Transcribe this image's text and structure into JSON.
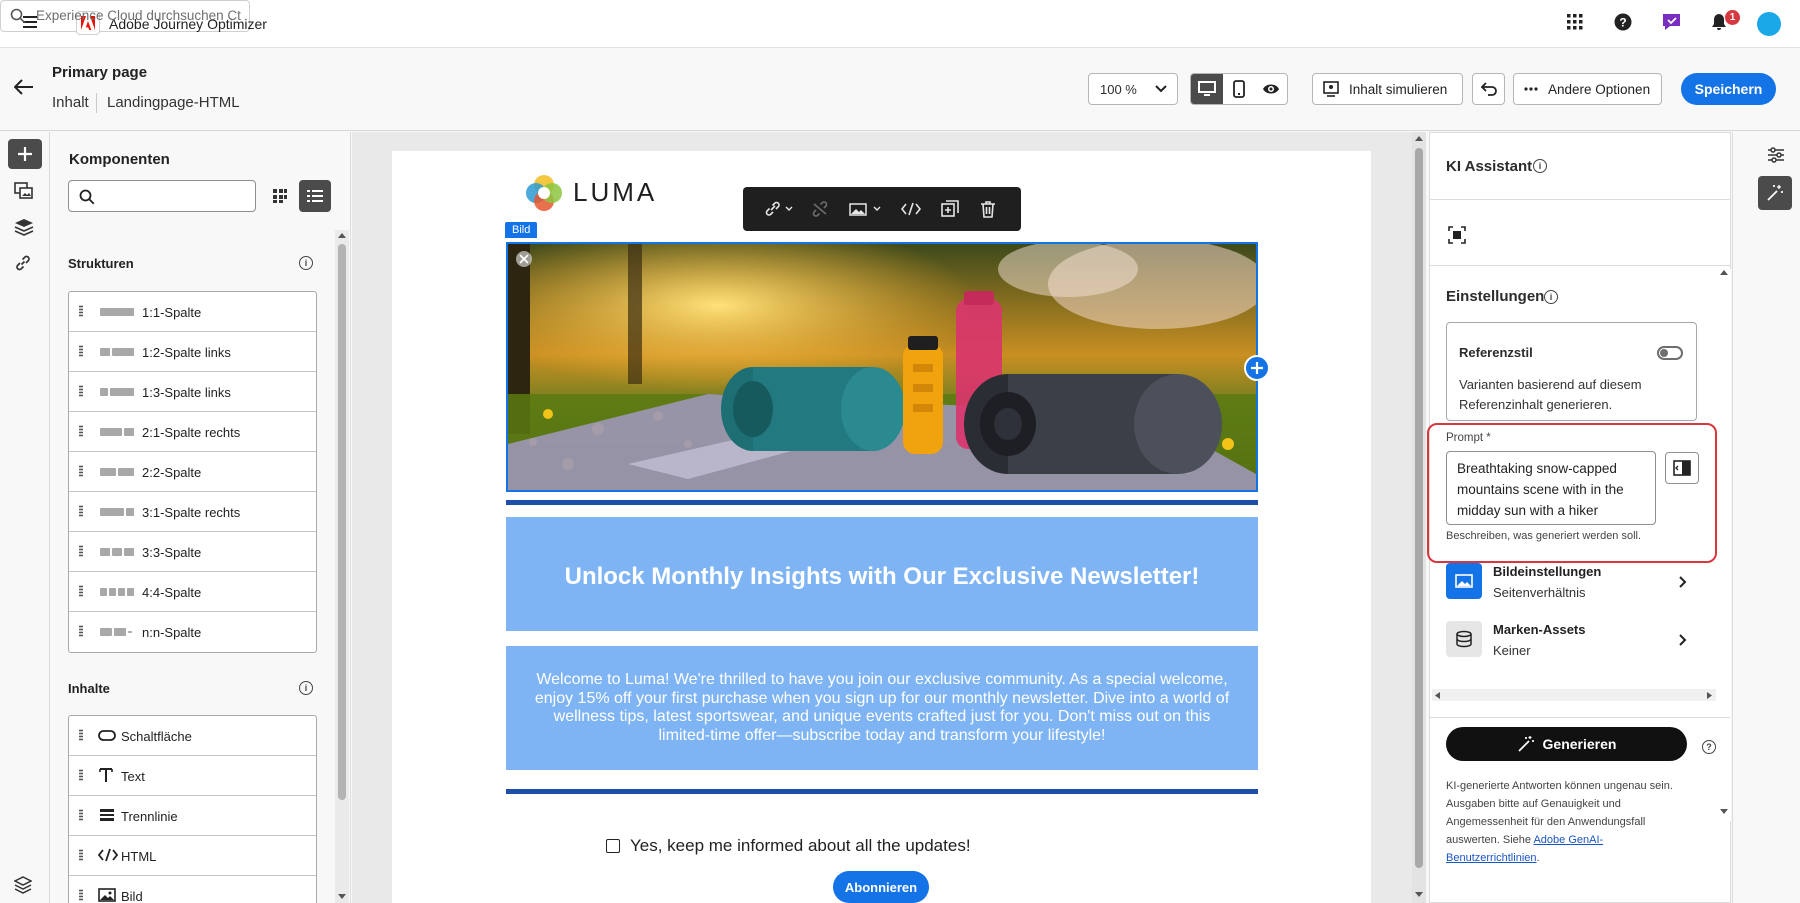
{
  "app": {
    "name": "Adobe Journey Optimizer",
    "search_placeholder": "Experience Cloud durchsuchen Ct...",
    "notification_count": "1"
  },
  "header": {
    "title": "Primary page",
    "breadcrumb": [
      "Inhalt",
      "Landingpage-HTML"
    ],
    "zoom": "100 %",
    "simulate_label": "Inhalt simulieren",
    "more_label": "Andere Optionen",
    "save_label": "Speichern"
  },
  "components": {
    "title": "Komponenten",
    "structures_title": "Strukturen",
    "structures": [
      {
        "label": "1:1-Spalte"
      },
      {
        "label": "1:2-Spalte links"
      },
      {
        "label": "1:3-Spalte links"
      },
      {
        "label": "2:1-Spalte rechts"
      },
      {
        "label": "2:2-Spalte"
      },
      {
        "label": "3:1-Spalte rechts"
      },
      {
        "label": "3:3-Spalte"
      },
      {
        "label": "4:4-Spalte"
      },
      {
        "label": "n:n-Spalte"
      }
    ],
    "contents_title": "Inhalte",
    "contents": [
      {
        "label": "Schaltfläche",
        "icon": "button-icon"
      },
      {
        "label": "Text",
        "icon": "text-icon"
      },
      {
        "label": "Trennlinie",
        "icon": "divider-icon"
      },
      {
        "label": "HTML",
        "icon": "code-icon"
      },
      {
        "label": "Bild",
        "icon": "image-icon"
      }
    ]
  },
  "canvas": {
    "logo_text": "LUMA",
    "selected_tag": "Bild",
    "headline": "Unlock Monthly Insights with Our Exclusive Newsletter!",
    "body": "Welcome to Luma! We're thrilled to have you join our exclusive community. As a special welcome, enjoy 15% off your first purchase when you sign up for our monthly newsletter. Dive into a world of wellness tips, latest sportswear, and unique events crafted just for you. Don't miss out on this limited-time offer—subscribe today and transform your lifestyle!",
    "checkbox_label": "Yes, keep me informed about all the updates!",
    "subscribe_label": "Abonnieren"
  },
  "ai_panel": {
    "title": "KI Assistant",
    "settings_title": "Einstellungen",
    "reference_title": "Referenzstil",
    "reference_desc_1": "Varianten basierend auf diesem",
    "reference_desc_2": "Referenzinhalt generieren.",
    "prompt_label": "Prompt *",
    "prompt_value": "Breathtaking snow-capped mountains scene with  in the midday sun with a hiker",
    "prompt_help": "Beschreiben, was generiert werden soll.",
    "image_settings_title": "Bildeinstellungen",
    "image_settings_sub": "Seitenverhältnis",
    "brand_assets_title": "Marken-Assets",
    "brand_assets_sub": "Keiner",
    "generate_label": "Generieren",
    "disclaimer": "KI-generierte Antworten können ungenau sein. Ausgaben bitte auf Genauigkeit und Angemessenheit für den Anwendungsfall auswerten. Siehe ",
    "disclaimer_link": "Adobe GenAI-Benutzerrichtlinien",
    "disclaimer_end": "."
  },
  "colors": {
    "accent": "#1473e6",
    "banner": "#7eb4f4",
    "rule": "#1b4fa8",
    "highlight": "#d7373f"
  }
}
